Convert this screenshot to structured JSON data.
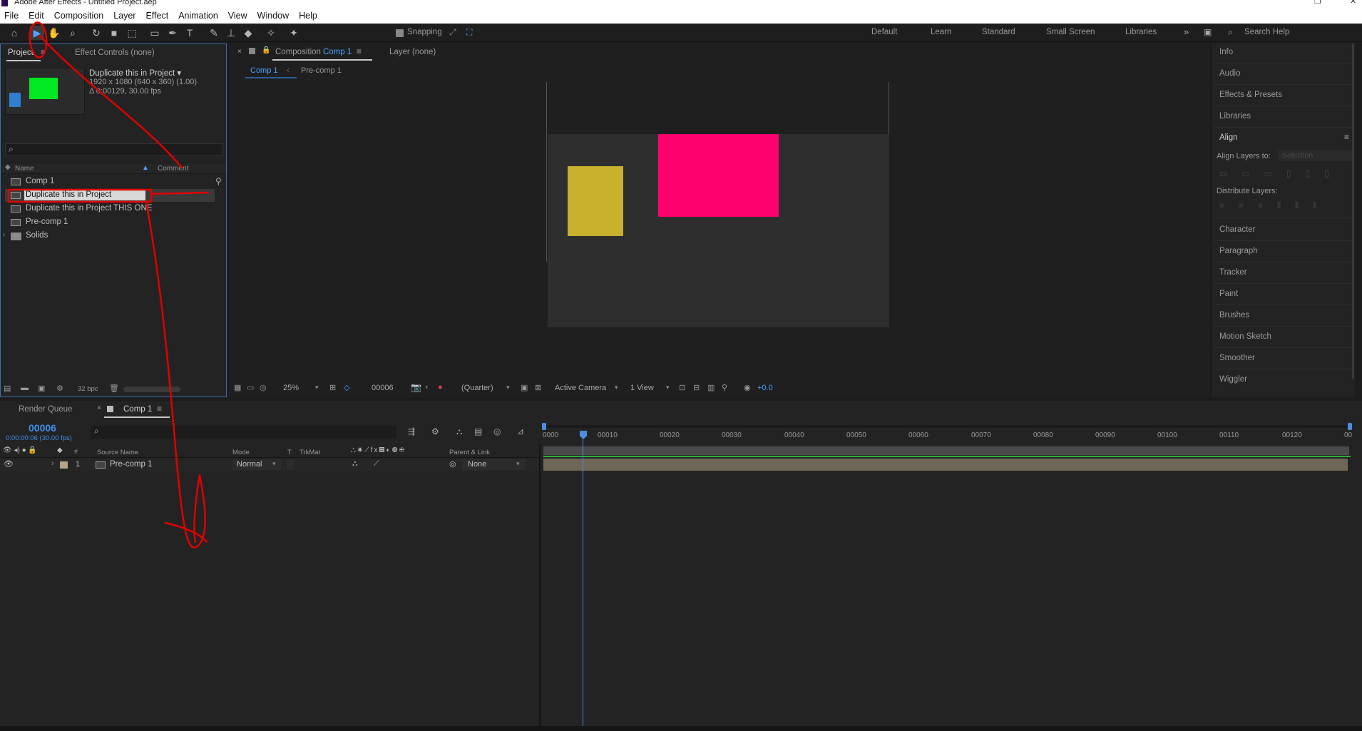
{
  "app": {
    "title": "Adobe After Effects - Untitled Project.aep"
  },
  "menu": [
    "File",
    "Edit",
    "Composition",
    "Layer",
    "Effect",
    "Animation",
    "View",
    "Window",
    "Help"
  ],
  "toolbar": {
    "snapping_label": "Snapping",
    "workspaces": [
      "Default",
      "Learn",
      "Standard",
      "Small Screen",
      "Libraries"
    ],
    "search_placeholder": "Search Help"
  },
  "project": {
    "tab_project": "Project",
    "tab_effect_controls": "Effect Controls (none)",
    "preview_name": "Duplicate this in Project ▾",
    "preview_res": "1920 x 1080  (640 x 360) (1.00)",
    "preview_dur": "Δ 0;00129, 30.00 fps",
    "search_placeholder": "",
    "col_name": "Name",
    "col_comment": "Comment",
    "items": [
      {
        "label": "Comp 1",
        "icon": "composition-icon"
      },
      {
        "label": "Duplicate this in Project",
        "icon": "composition-icon"
      },
      {
        "label": "Duplicate this in Project THIS ONE",
        "icon": "composition-icon"
      },
      {
        "label": "Pre-comp 1",
        "icon": "composition-icon"
      },
      {
        "label": "Solids",
        "icon": "folder-icon"
      }
    ],
    "bpc": "32 bpc"
  },
  "viewer": {
    "tab_comp_prefix": "Composition",
    "tab_comp_name": "Comp 1",
    "tab_layer": "Layer (none)",
    "breadcrumb": [
      "Comp 1",
      "Pre-comp 1"
    ],
    "zoom": "25%",
    "timecode": "00006",
    "resolution": "(Quarter)",
    "camera": "Active Camera",
    "views": "1 View",
    "exposure": "+0.0",
    "colors": {
      "pink": "#ff006e",
      "gold": "#c6b02c"
    }
  },
  "right_panel": {
    "items_top": [
      "Info",
      "Audio",
      "Effects & Presets",
      "Libraries"
    ],
    "align_title": "Align",
    "align_layers_to": "Align Layers to:",
    "align_selection": "Selection",
    "distribute_layers": "Distribute Layers:",
    "items_bottom": [
      "Character",
      "Paragraph",
      "Tracker",
      "Paint",
      "Brushes",
      "Motion Sketch",
      "Smoother",
      "Wiggler"
    ]
  },
  "timeline": {
    "tab_render_queue": "Render Queue",
    "tab_comp": "Comp 1",
    "timecode": "00006",
    "timecode_sub": "0:00:00:06 (30.00 fps)",
    "col_source_name": "Source Name",
    "col_mode": "Mode",
    "col_t": "T",
    "col_trkmat": "TrkMat",
    "col_parent": "Parent & Link",
    "layer": {
      "index": "1",
      "name": "Pre-comp 1",
      "mode": "Normal",
      "parent": "None"
    },
    "ticks": [
      "0000",
      "00010",
      "00020",
      "00030",
      "00040",
      "00050",
      "00060",
      "00070",
      "00080",
      "00090",
      "00100",
      "00110",
      "00120",
      "00"
    ]
  }
}
